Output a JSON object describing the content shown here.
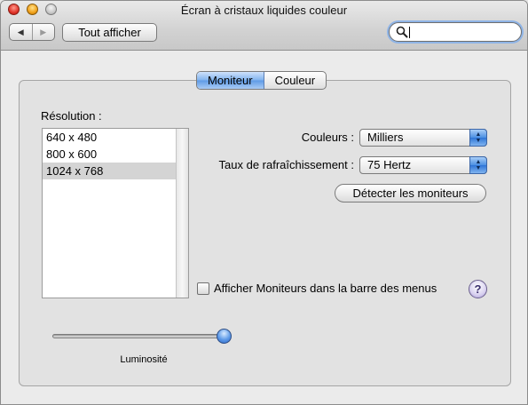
{
  "window": {
    "title": "Écran à cristaux liquides couleur"
  },
  "toolbar": {
    "back_icon": "◀",
    "forward_icon": "▶",
    "show_all_label": "Tout afficher",
    "search_value": "",
    "search_icon": "magnifier-icon"
  },
  "tabs": [
    {
      "label": "Moniteur",
      "selected": true
    },
    {
      "label": "Couleur",
      "selected": false
    }
  ],
  "resolution": {
    "label": "Résolution :",
    "options": [
      "640 x 480",
      "800 x 600",
      "1024 x 768"
    ],
    "selected": "1024 x 768"
  },
  "colors_popup": {
    "label": "Couleurs :",
    "value": "Milliers"
  },
  "refresh_popup": {
    "label": "Taux de rafraîchissement :",
    "value": "75 Hertz"
  },
  "detect_button": {
    "label": "Détecter les moniteurs"
  },
  "menubar_checkbox": {
    "label": "Afficher Moniteurs dans la barre des menus",
    "checked": false
  },
  "help_button": {
    "label": "?"
  },
  "brightness": {
    "label": "Luminosité",
    "level": 1.0
  },
  "colors": {
    "accent": "#5e9ae6",
    "help": "#a899d6"
  }
}
